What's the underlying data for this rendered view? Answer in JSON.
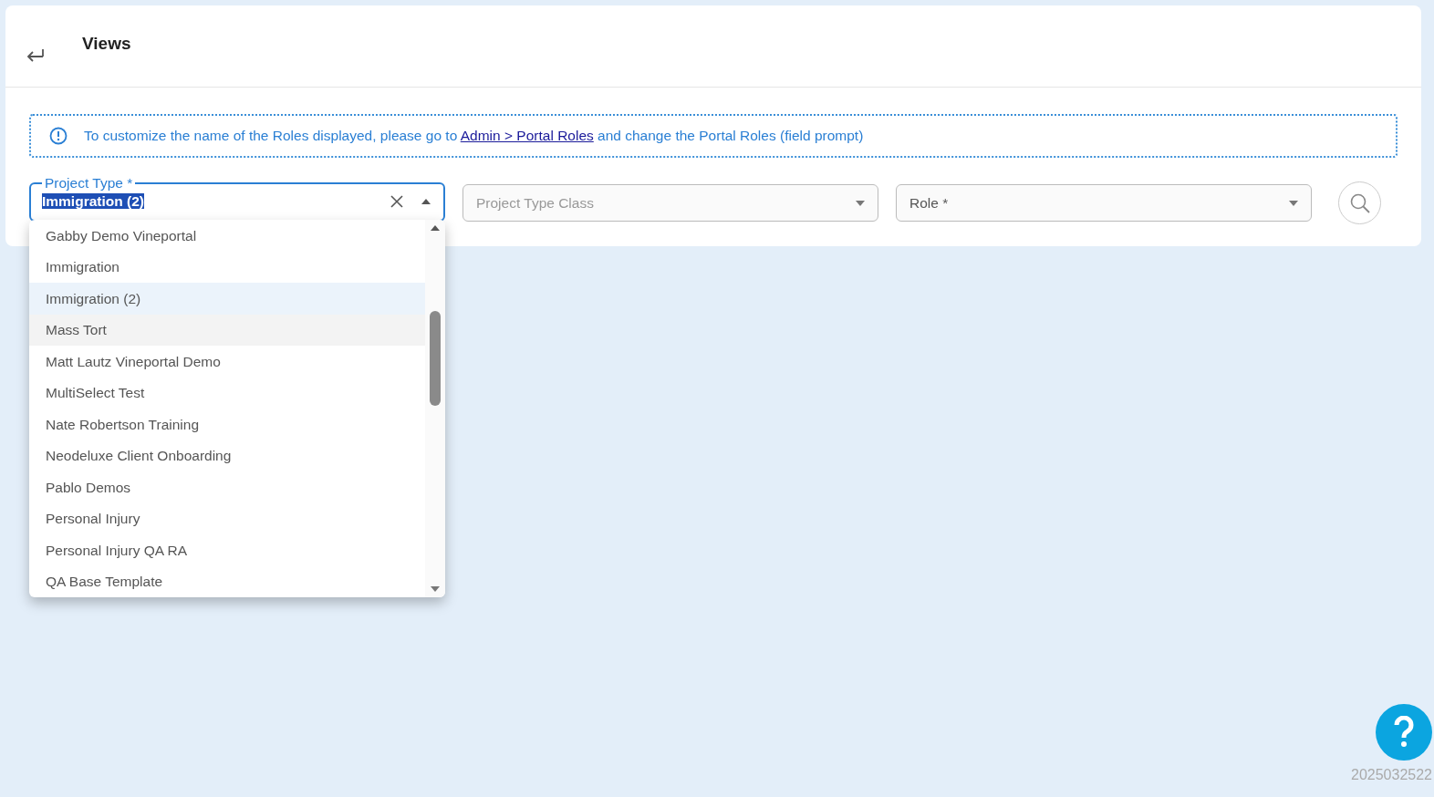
{
  "header": {
    "title": "Views"
  },
  "notice": {
    "before": "To customize the name of the Roles displayed, please go to",
    "link": "Admin > Portal Roles",
    "after": "and change the Portal Roles (field prompt)"
  },
  "filters": {
    "project_type": {
      "label": "Project Type *",
      "value": "Immigration (2)",
      "text_selected": true,
      "open": true
    },
    "project_type_class": {
      "placeholder": "Project Type Class"
    },
    "role": {
      "placeholder": "Role *"
    }
  },
  "options": [
    {
      "label": "Gabby Demo Vineportal",
      "selected": false,
      "hovered": false
    },
    {
      "label": "Immigration",
      "selected": false,
      "hovered": false
    },
    {
      "label": "Immigration (2)",
      "selected": true,
      "hovered": false
    },
    {
      "label": "Mass Tort",
      "selected": false,
      "hovered": true
    },
    {
      "label": "Matt Lautz Vineportal Demo",
      "selected": false,
      "hovered": false
    },
    {
      "label": "MultiSelect Test",
      "selected": false,
      "hovered": false
    },
    {
      "label": "Nate Robertson Training",
      "selected": false,
      "hovered": false
    },
    {
      "label": "Neodeluxe Client Onboarding",
      "selected": false,
      "hovered": false
    },
    {
      "label": "Pablo Demos",
      "selected": false,
      "hovered": false
    },
    {
      "label": "Personal Injury",
      "selected": false,
      "hovered": false
    },
    {
      "label": "Personal Injury QA RA",
      "selected": false,
      "hovered": false
    },
    {
      "label": "QA Base Template",
      "selected": false,
      "hovered": false
    }
  ],
  "version": "2025032522"
}
